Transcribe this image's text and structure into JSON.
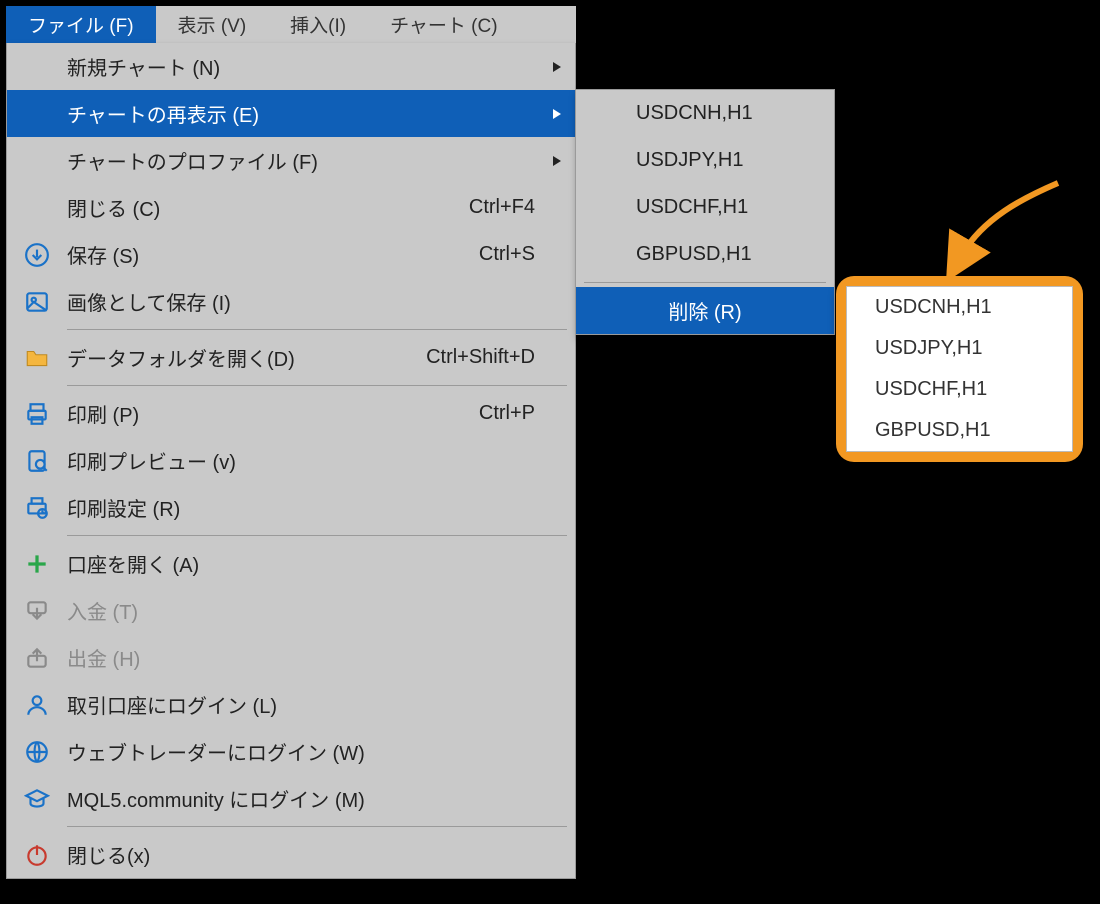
{
  "menubar": {
    "tabs": [
      {
        "label": "ファイル (F)",
        "selected": true
      },
      {
        "label": "表示 (V)"
      },
      {
        "label": "挿入(I)"
      },
      {
        "label": "チャート (C)"
      }
    ]
  },
  "file_menu": [
    {
      "icon": "",
      "label": "新規チャート (N)",
      "submenu": true
    },
    {
      "icon": "",
      "label": "チャートの再表示 (E)",
      "submenu": true,
      "selected": true
    },
    {
      "icon": "",
      "label": "チャートのプロファイル (F)",
      "submenu": true
    },
    {
      "icon": "",
      "label": "閉じる (C)",
      "accel": "Ctrl+F4"
    },
    {
      "icon": "download",
      "label": "保存 (S)",
      "accel": "Ctrl+S"
    },
    {
      "icon": "image",
      "label": "画像として保存 (I)"
    },
    {
      "sep": true
    },
    {
      "icon": "folder",
      "label": "データフォルダを開く(D)",
      "accel": "Ctrl+Shift+D"
    },
    {
      "sep": true
    },
    {
      "icon": "print",
      "label": "印刷 (P)",
      "accel": "Ctrl+P"
    },
    {
      "icon": "preview",
      "label": "印刷プレビュー (v)"
    },
    {
      "icon": "printset",
      "label": "印刷設定 (R)"
    },
    {
      "sep": true
    },
    {
      "icon": "plus",
      "label": "口座を開く (A)"
    },
    {
      "icon": "deposit",
      "label": "入金 (T)",
      "disabled": true
    },
    {
      "icon": "withdraw",
      "label": "出金 (H)",
      "disabled": true
    },
    {
      "icon": "user",
      "label": "取引口座にログイン (L)"
    },
    {
      "icon": "web",
      "label": "ウェブトレーダーにログイン (W)"
    },
    {
      "icon": "mql5",
      "label": "MQL5.community にログイン (M)"
    },
    {
      "sep": true
    },
    {
      "icon": "power",
      "label": "閉じる(x)"
    }
  ],
  "submenu": {
    "items": [
      "USDCNH,H1",
      "USDJPY,H1",
      "USDCHF,H1",
      "GBPUSD,H1"
    ],
    "delete_label": "削除 (R)"
  },
  "popup": {
    "items": [
      "USDCNH,H1",
      "USDJPY,H1",
      "USDCHF,H1",
      "GBPUSD,H1"
    ]
  }
}
